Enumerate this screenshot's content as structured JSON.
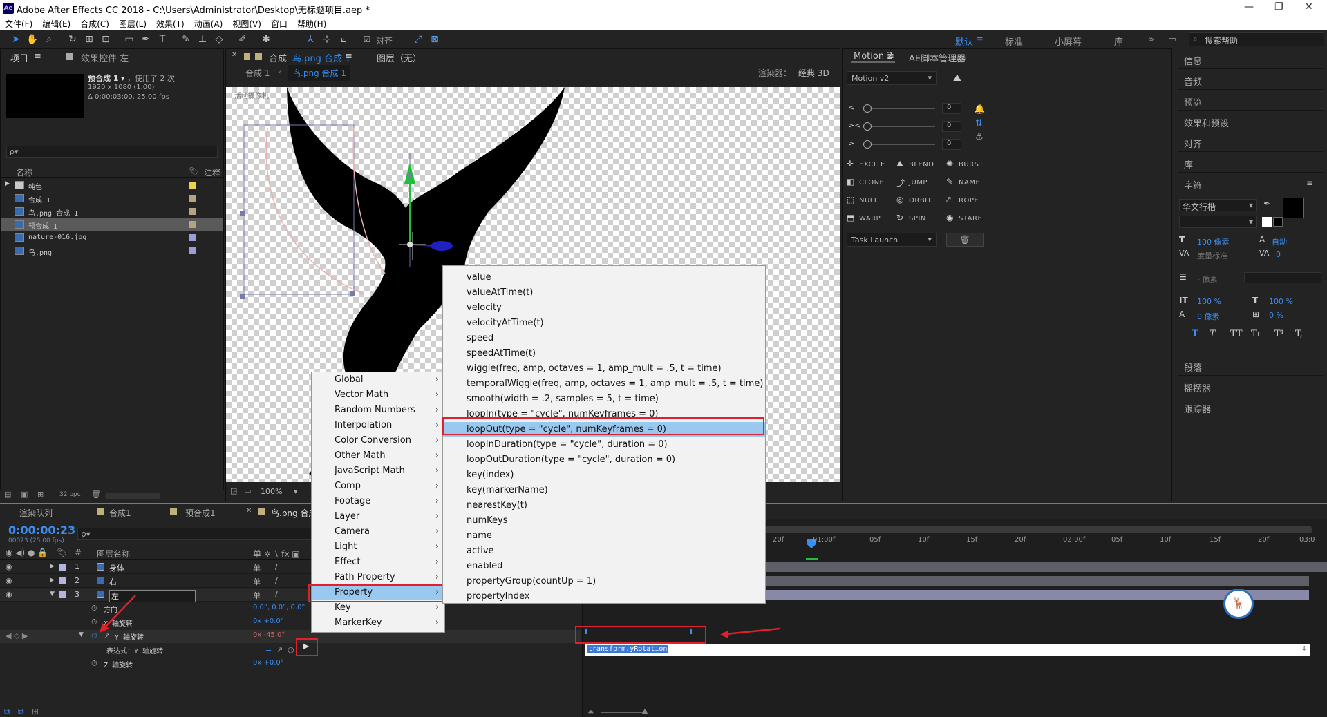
{
  "window": {
    "title": "Adobe After Effects CC 2018 - C:\\Users\\Administrator\\Desktop\\无标题项目.aep *",
    "app_icon": "Ae"
  },
  "menu": [
    "文件(F)",
    "编辑(E)",
    "合成(C)",
    "图层(L)",
    "效果(T)",
    "动画(A)",
    "视图(V)",
    "窗口",
    "帮助(H)"
  ],
  "toolbar": {
    "align_label": "对齐",
    "workspaces": [
      "默认",
      "标准",
      "小屏幕",
      "库"
    ],
    "search_placeholder": "搜索帮助",
    "active_workspace": "默认"
  },
  "project": {
    "tabs": [
      "项目",
      "效果控件 左"
    ],
    "item_name": "预合成 1",
    "item_usage": "，使用了 2 次",
    "item_dims": "1920 x 1080 (1.00)",
    "item_duration": "Δ 0:00:03:00, 25.00 fps",
    "search_placeholder": "ρ▾",
    "col_name": "名称",
    "col_comment": "注释",
    "items": [
      {
        "name": "纯色",
        "type": "folder",
        "color": "#e8d44d"
      },
      {
        "name": "合成 1",
        "type": "comp",
        "color": "#b6a384"
      },
      {
        "name": "鸟.png 合成 1",
        "type": "comp",
        "color": "#b6a384"
      },
      {
        "name": "预合成 1",
        "type": "comp",
        "color": "#b6a384",
        "selected": true
      },
      {
        "name": "nature-016.jpg",
        "type": "file",
        "color": "#9d9dd6"
      },
      {
        "name": "鸟.png",
        "type": "file",
        "color": "#9d9dd6"
      }
    ],
    "bpc": "32 bpc"
  },
  "composition": {
    "tab_label": "合成",
    "tab_comp": "鸟.png 合成 1",
    "layer_tab": "图层（无）",
    "breadcrumb": [
      "合成 1",
      "鸟.png 合成 1"
    ],
    "renderer_label": "渲染器：",
    "renderer_value": "经典 3D",
    "overlay_label": "活动摄像机",
    "zoom": "100%"
  },
  "motion": {
    "tabs": [
      "Motion 2",
      "AE脚本管理器"
    ],
    "preset": "Motion v2",
    "sliders": [
      {
        "icon": "<",
        "value": "0"
      },
      {
        "icon": "><",
        "value": "0"
      },
      {
        "icon": ">",
        "value": "0"
      }
    ],
    "buttons": [
      [
        "EXCITE",
        "BLEND",
        "BURST"
      ],
      [
        "CLONE",
        "JUMP",
        "NAME"
      ],
      [
        "NULL",
        "ORBIT",
        "ROPE"
      ],
      [
        "WARP",
        "SPIN",
        "STARE"
      ]
    ],
    "task": "Task Launch"
  },
  "right_panels": [
    "信息",
    "音频",
    "预览",
    "效果和预设",
    "对齐",
    "库",
    "字符",
    "段落",
    "摇摆器",
    "跟踪器"
  ],
  "character": {
    "font": "华文行楷",
    "style": "-",
    "size": "100 像素",
    "leading": "自动",
    "kerning": "度量标准",
    "tracking": "0",
    "stroke": "- 像素",
    "vscale": "100 %",
    "hscale": "100 %",
    "baseline": "0 像素",
    "tsume": "0 %",
    "styles": [
      "T",
      "T",
      "TT",
      "Tr",
      "T¹",
      "T,"
    ]
  },
  "timeline": {
    "tabs": [
      "渲染队列",
      "合成1",
      "预合成1",
      "鸟.png 合成1"
    ],
    "timecode": "0:00:00:23",
    "frame_info": "00023 (25.00 fps)",
    "col_layer": "图层名称",
    "layers": [
      {
        "num": "1",
        "name": "身体"
      },
      {
        "num": "2",
        "name": "右"
      },
      {
        "num": "3",
        "name": "左"
      }
    ],
    "props": [
      {
        "name": "方向",
        "value": "0.0°, 0.0°, 0.0°"
      },
      {
        "name": "X 轴旋转",
        "value": "0x +0.0°"
      },
      {
        "name": "Y 轴旋转",
        "value": "0x -45.0°"
      },
      {
        "name": "表达式：Y 轴旋转",
        "value": ""
      },
      {
        "name": "Z 轴旋转",
        "value": "0x +0.0°"
      }
    ],
    "ruler": [
      "20f",
      "01:00f",
      "05f",
      "10f",
      "15f",
      "20f",
      "02:00f",
      "05f",
      "10f",
      "15f",
      "20f",
      "03:0"
    ],
    "expression": "transform.yRotation"
  },
  "context_menu_left": [
    "Global",
    "Vector Math",
    "Random Numbers",
    "Interpolation",
    "Color Conversion",
    "Other Math",
    "JavaScript Math",
    "Comp",
    "Footage",
    "Layer",
    "Camera",
    "Light",
    "Effect",
    "Path Property",
    "Property",
    "Key",
    "MarkerKey"
  ],
  "context_menu_left_selected": "Property",
  "context_menu_right": [
    "value",
    "valueAtTime(t)",
    "velocity",
    "velocityAtTime(t)",
    "speed",
    "speedAtTime(t)",
    "wiggle(freq, amp, octaves = 1, amp_mult = .5, t = time)",
    "temporalWiggle(freq, amp, octaves = 1, amp_mult = .5, t = time)",
    "smooth(width = .2, samples = 5, t = time)",
    "loopIn(type = \"cycle\", numKeyframes = 0)",
    "loopOut(type = \"cycle\", numKeyframes = 0)",
    "loopInDuration(type = \"cycle\", duration = 0)",
    "loopOutDuration(type = \"cycle\", duration = 0)",
    "key(index)",
    "key(markerName)",
    "nearestKey(t)",
    "numKeys",
    "name",
    "active",
    "enabled",
    "propertyGroup(countUp = 1)",
    "propertyIndex"
  ],
  "context_menu_right_selected": "loopOut(type = \"cycle\", numKeyframes = 0)",
  "colors": {
    "accent": "#2d8ceb",
    "highlight": "#99c9ef",
    "annotation": "#e0202c"
  }
}
